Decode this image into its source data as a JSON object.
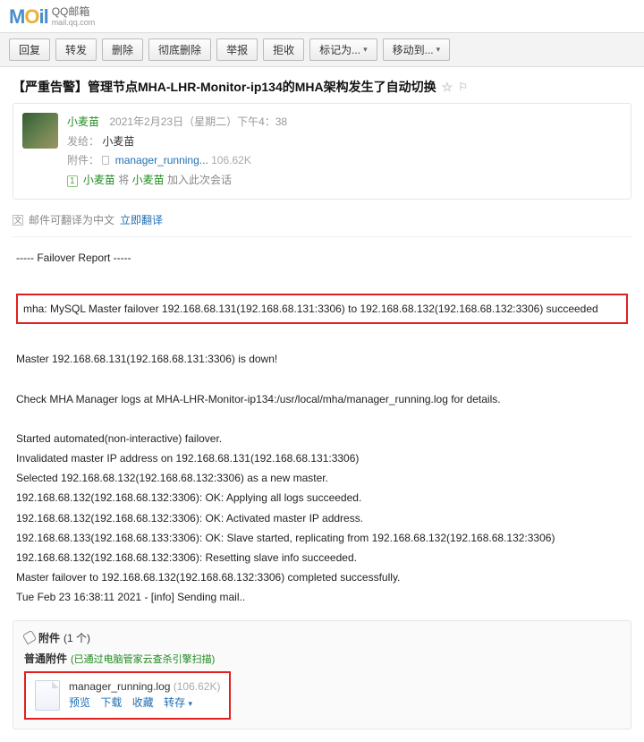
{
  "logo": {
    "brand1": "M",
    "brandO": "O",
    "brand2": "il",
    "cn": "QQ邮箱",
    "en": "mail.qq.com"
  },
  "toolbar": {
    "reply": "回复",
    "forward": "转发",
    "delete": "删除",
    "delete_forever": "彻底删除",
    "report": "举报",
    "reject": "拒收",
    "mark_as": "标记为...",
    "move_to": "移动到..."
  },
  "subject": "【严重告警】管理节点MHA-LHR-Monitor-ip134的MHA架构发生了自动切换",
  "meta": {
    "sender": "小麦苗",
    "time": "2021年2月23日（星期二）下午4：38",
    "to_label": "发给：",
    "to": "小麦苗",
    "attach_label": "附件：",
    "attach_name": "manager_running...",
    "attach_size": "106.62K",
    "conv_prefix": "1",
    "conv_a": "小麦苗",
    "conv_mid": "将",
    "conv_b": "小麦苗",
    "conv_tail": "加入此次会话"
  },
  "translate": {
    "text": "邮件可翻译为中文",
    "action": "立即翻译"
  },
  "body": {
    "l1": "----- Failover Report -----",
    "l2": "mha: MySQL Master failover 192.168.68.131(192.168.68.131:3306) to 192.168.68.132(192.168.68.132:3306) succeeded",
    "l3": "Master 192.168.68.131(192.168.68.131:3306) is down!",
    "l4": "Check MHA Manager logs at MHA-LHR-Monitor-ip134:/usr/local/mha/manager_running.log for details.",
    "l5": "Started automated(non-interactive) failover.",
    "l6": "Invalidated master IP address on 192.168.68.131(192.168.68.131:3306)",
    "l7": "Selected 192.168.68.132(192.168.68.132:3306) as a new master.",
    "l8": "192.168.68.132(192.168.68.132:3306): OK: Applying all logs succeeded.",
    "l9": "192.168.68.132(192.168.68.132:3306): OK: Activated master IP address.",
    "l10": "192.168.68.133(192.168.68.133:3306): OK: Slave started, replicating from 192.168.68.132(192.168.68.132:3306)",
    "l11": "192.168.68.132(192.168.68.132:3306): Resetting slave info succeeded.",
    "l12": "Master failover to 192.168.68.132(192.168.68.132:3306) completed successfully.",
    "l13": "Tue Feb 23 16:38:11 2021 - [info] Sending mail.."
  },
  "attach": {
    "head": "附件",
    "count": "(1 个)",
    "sub": "普通附件",
    "scan": "(已通过电脑管家云查杀引擎扫描)",
    "file_name": "manager_running.log",
    "file_size": "(106.62K)",
    "preview": "预览",
    "download": "下载",
    "favorite": "收藏",
    "transfer": "转存"
  }
}
